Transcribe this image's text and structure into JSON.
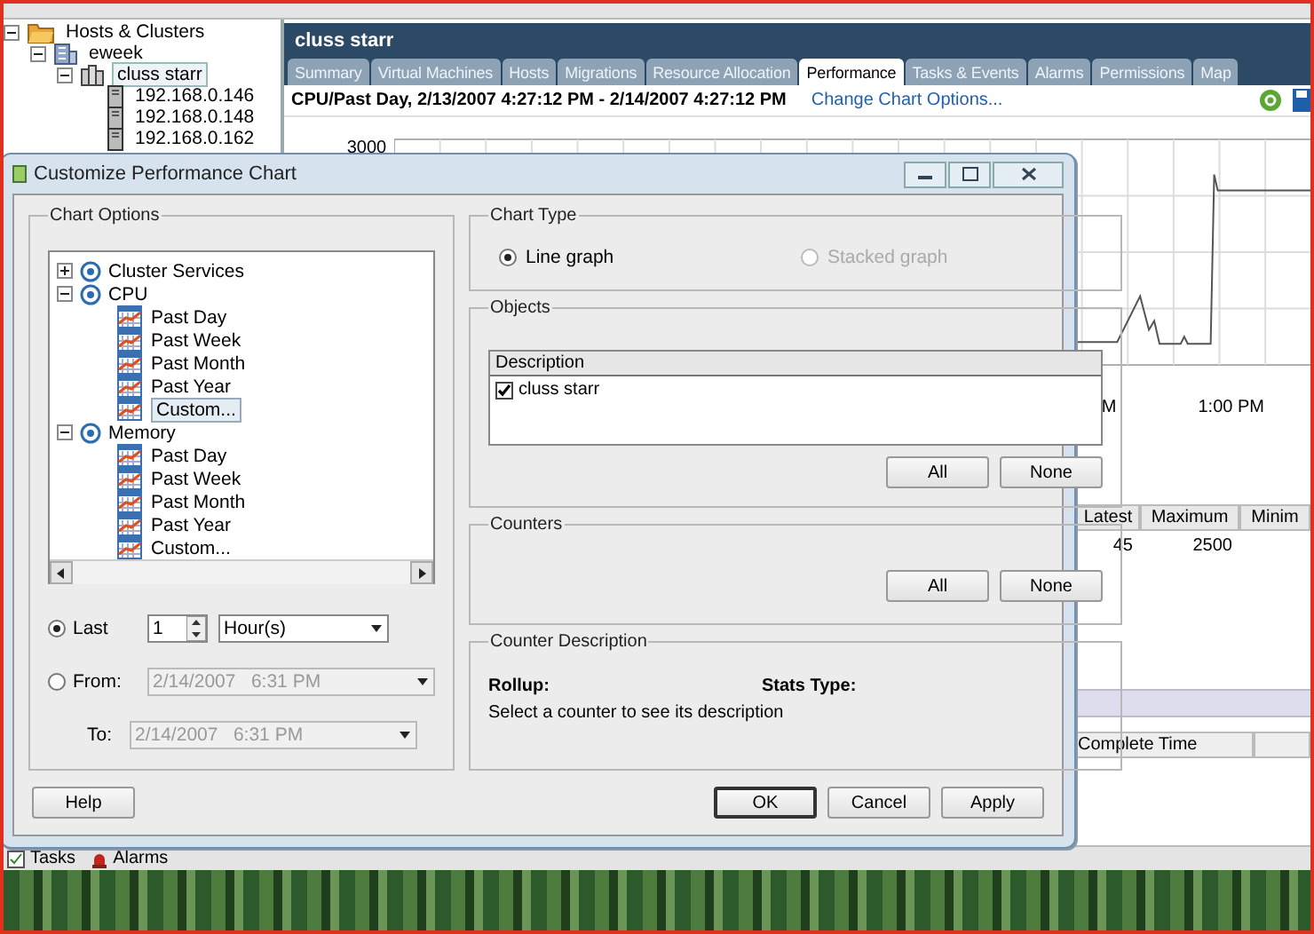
{
  "explorer": {
    "tree": [
      {
        "label": "Hosts & Clusters",
        "kind": "folder",
        "selected": false,
        "expanded": true,
        "children": [
          {
            "label": "eweek",
            "kind": "datacenter",
            "selected": false,
            "expanded": true,
            "children": [
              {
                "label": "cluss starr",
                "kind": "cluster",
                "selected": true,
                "expanded": true,
                "children": [
                  {
                    "label": "192.168.0.146",
                    "kind": "host",
                    "selected": false
                  },
                  {
                    "label": "192.168.0.148",
                    "kind": "host",
                    "selected": false
                  },
                  {
                    "label": "192.168.0.162",
                    "kind": "host",
                    "selected": false
                  }
                ]
              }
            ]
          }
        ]
      }
    ]
  },
  "main": {
    "title": "cluss starr",
    "tabs": [
      {
        "label": "Summary",
        "selected": false
      },
      {
        "label": "Virtual Machines",
        "selected": false
      },
      {
        "label": "Hosts",
        "selected": false
      },
      {
        "label": "Migrations",
        "selected": false
      },
      {
        "label": "Resource Allocation",
        "selected": false
      },
      {
        "label": "Performance",
        "selected": true
      },
      {
        "label": "Tasks & Events",
        "selected": false
      },
      {
        "label": "Alarms",
        "selected": false
      },
      {
        "label": "Permissions",
        "selected": false
      },
      {
        "label": "Map",
        "selected": false
      }
    ],
    "chart_title": "CPU/Past Day, 2/13/2007 4:27:12 PM - 2/14/2007 4:27:12 PM",
    "chart_link": "Change Chart Options...",
    "chart": {
      "y_tick": "3000",
      "x_ticks": [
        "M",
        "1:00 PM"
      ]
    },
    "stats": {
      "columns": [
        "Latest",
        "Maximum",
        "Minim"
      ],
      "rows": [
        [
          "45",
          "2500"
        ]
      ]
    },
    "tasks_table": {
      "columns": [
        "Complete Time"
      ]
    }
  },
  "status_bar": [
    {
      "label": "Tasks",
      "kind": "tasks"
    },
    {
      "label": "Alarms",
      "kind": "alarms"
    }
  ],
  "dialog": {
    "title": "Customize Performance Chart",
    "chart_options": {
      "title": "Chart Options",
      "tree": [
        {
          "label": "Cluster Services",
          "expanded": false
        },
        {
          "label": "CPU",
          "expanded": true,
          "children": [
            {
              "label": "Past Day",
              "selected": false
            },
            {
              "label": "Past Week",
              "selected": false
            },
            {
              "label": "Past Month",
              "selected": false
            },
            {
              "label": "Past Year",
              "selected": false
            },
            {
              "label": "Custom...",
              "selected": true
            }
          ]
        },
        {
          "label": "Memory",
          "expanded": true,
          "children": [
            {
              "label": "Past Day",
              "selected": false
            },
            {
              "label": "Past Week",
              "selected": false
            },
            {
              "label": "Past Month",
              "selected": false
            },
            {
              "label": "Past Year",
              "selected": false
            },
            {
              "label": "Custom...",
              "selected": false
            }
          ]
        }
      ],
      "range": {
        "last": {
          "label": "Last",
          "selected": true,
          "count": "1",
          "unit": "Hour(s)"
        },
        "from": {
          "label": "From:",
          "selected": false,
          "value": "2/14/2007   6:31 PM",
          "disabled": true
        },
        "to": {
          "label": "To:",
          "value": "2/14/2007   6:31 PM",
          "disabled": true
        }
      }
    },
    "chart_type": {
      "title": "Chart Type",
      "options": [
        {
          "label": "Line graph",
          "selected": true,
          "disabled": false
        },
        {
          "label": "Stacked graph",
          "selected": false,
          "disabled": true
        }
      ]
    },
    "objects": {
      "title": "Objects",
      "column": "Description",
      "rows": [
        {
          "label": "cluss starr",
          "checked": true
        }
      ],
      "buttons": [
        "All",
        "None"
      ]
    },
    "counters": {
      "title": "Counters",
      "buttons": [
        "All",
        "None"
      ]
    },
    "counter_description": {
      "title": "Counter Description",
      "rollup_label": "Rollup:",
      "stats_type_label": "Stats Type:",
      "text": "Select a counter to see its description"
    },
    "buttons": [
      {
        "label": "Help",
        "kind": "help"
      },
      {
        "label": "OK",
        "kind": "default"
      },
      {
        "label": "Cancel",
        "kind": "normal"
      },
      {
        "label": "Apply",
        "kind": "normal"
      }
    ]
  }
}
